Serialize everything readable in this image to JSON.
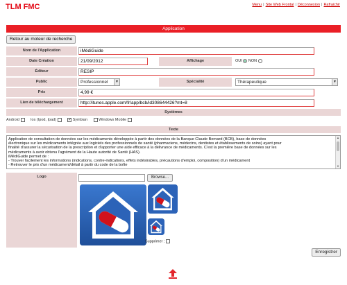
{
  "site_title": "TLM FMC",
  "topnav": [
    {
      "label": "Menu"
    },
    {
      "label": "Site Web Frontal"
    },
    {
      "label": "Déconnexion"
    },
    {
      "label": "Rafraichir"
    }
  ],
  "section_title": "Application",
  "back_label": "Retour au moteur de recherche",
  "form": {
    "nom_label": "Nom de l'Application",
    "nom_value": "iMédiGuide",
    "date_label": "Date Création",
    "date_value": "21/09/2012",
    "affichage_label": "Affichage",
    "affichage_oui": "OUI",
    "affichage_non": "NON",
    "editeur_label": "Éditeur",
    "editeur_value": "RESIP",
    "public_label": "Public",
    "public_value": "Professionnel",
    "specialite_label": "Spécialité",
    "specialite_value": "Thérapeutique",
    "prix_label": "Prix",
    "prix_value": "4,99 €",
    "lien_label": "Lien de téléchargement",
    "lien_value": "http://itunes.apple.com/fr/app/bcb/id308644426?mt=8"
  },
  "systemes": {
    "title": "Systèmes",
    "items": [
      {
        "label": "Android",
        "checked": false
      },
      {
        "label": "Ios (Ipod, Ipad)",
        "checked": false
      },
      {
        "label": "Symbian",
        "checked": true
      },
      {
        "label": "Windows Mobile",
        "checked": false
      }
    ]
  },
  "texte": {
    "title": "Texte",
    "lines": [
      "Application de consultation de données sur les médicaments développée à partir des données de la Banque Claude Bernard (BCB), base de données",
      "électronique sur les médicaments intégrée aux logiciels des professionnels de santé (pharmaciens, médecins, dentistes et établissements de soins) ayant pour",
      "finalité d'assurer la sécurisation de la prescription et d'apporter une aide efficace à la délivrance de médicaments. C'est la première base de données sur les",
      "médicaments à avoir obtenu l'agrément de la Haute autorité de Santé (HAS).",
      "iMédiGuide permet de :",
      "- Trouver facilement les informations (indications, contre-indications, effets indésirables, précautions d'emploi, composition) d'un médicament",
      "- Retrouver le prix d'un médicament/détail à partir du code de la boîte"
    ]
  },
  "logo": {
    "label": "Logo",
    "browse_label": "Browse...",
    "supprimer_label": "Supprimer :"
  },
  "save_label": "Enregistrer",
  "colors": {
    "accent": "#ea1f26",
    "label_bg": "#ead6d6",
    "icon_blue": "#2c63b8"
  }
}
